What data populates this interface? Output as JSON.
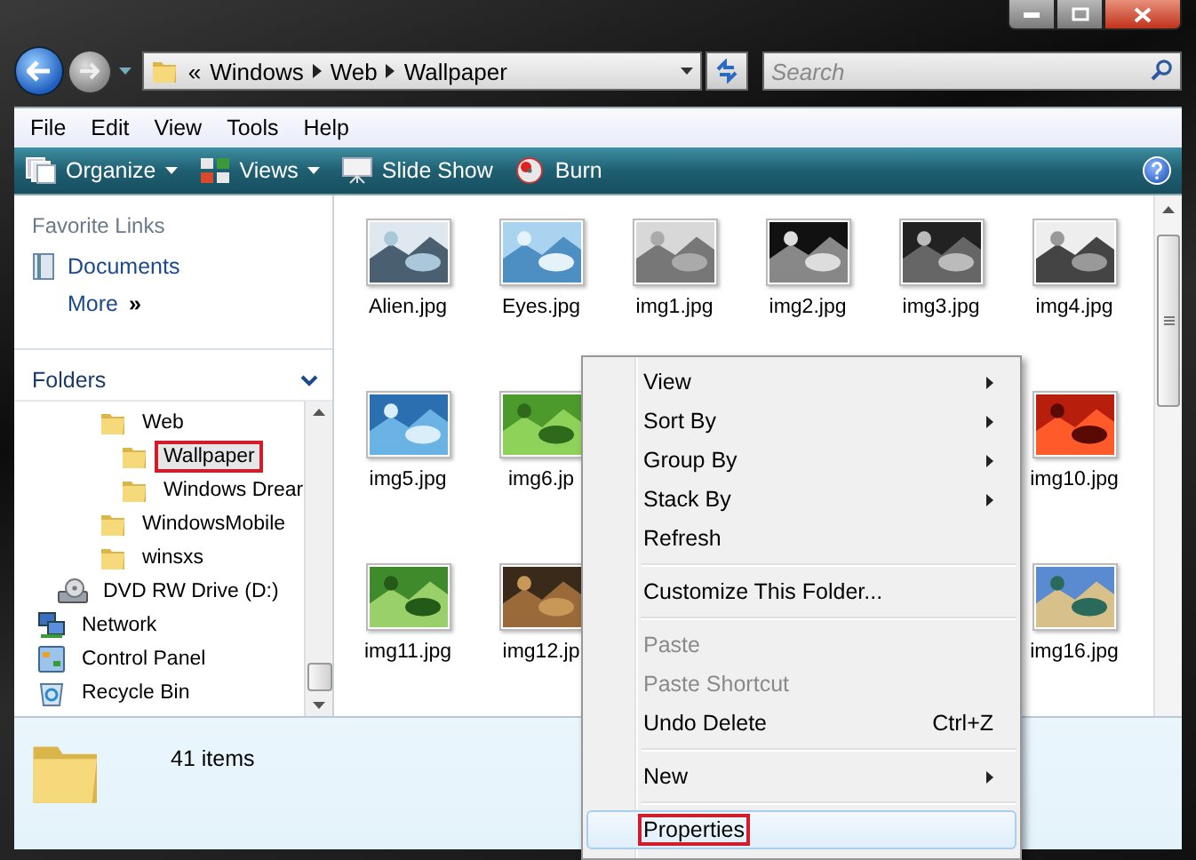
{
  "address_bar": {
    "overflow": "«",
    "crumbs": [
      "Windows",
      "Web",
      "Wallpaper"
    ]
  },
  "search": {
    "placeholder": "Search"
  },
  "menu_bar": [
    "File",
    "Edit",
    "View",
    "Tools",
    "Help"
  ],
  "toolbar": [
    {
      "label": "Organize",
      "kind": "organize",
      "has_menu": true
    },
    {
      "label": "Views",
      "kind": "views",
      "has_menu": true
    },
    {
      "label": "Slide Show",
      "kind": "slideshow",
      "has_menu": false
    },
    {
      "label": "Burn",
      "kind": "burn",
      "has_menu": false
    }
  ],
  "navigation_pane": {
    "favorites_title": "Favorite Links",
    "favorites": [
      {
        "label": "Documents",
        "kind": "documents"
      },
      {
        "label": "More",
        "kind": "more",
        "suffix": "»"
      }
    ],
    "folders_title": "Folders",
    "tree": [
      {
        "children": [
          {
            "children": [
              {
                "children": [
                  {
                    "label": "Web",
                    "kind": "folder",
                    "selected": false,
                    "highlighted": false,
                    "children": [
                      {
                        "label": "Wallpaper",
                        "kind": "folder",
                        "selected": true,
                        "highlighted": true
                      },
                      {
                        "label": "Windows Drear",
                        "kind": "folder",
                        "selected": false,
                        "highlighted": false
                      }
                    ]
                  },
                  {
                    "label": "WindowsMobile",
                    "kind": "folder",
                    "selected": false,
                    "highlighted": false
                  },
                  {
                    "label": "winsxs",
                    "kind": "folder",
                    "selected": false,
                    "highlighted": false
                  }
                ]
              }
            ]
          },
          {
            "label": "DVD RW Drive (D:)",
            "kind": "drive",
            "selected": false,
            "highlighted": false
          }
        ]
      },
      {
        "label": "Network",
        "kind": "network",
        "selected": false,
        "highlighted": false
      },
      {
        "label": "Control Panel",
        "kind": "control-panel",
        "selected": false,
        "highlighted": false
      },
      {
        "label": "Recycle Bin",
        "kind": "recycle-bin",
        "selected": false,
        "highlighted": false
      }
    ]
  },
  "files": {
    "rows": [
      [
        {
          "name": "Alien.jpg"
        },
        {
          "name": "Eyes.jpg"
        },
        {
          "name": "img1.jpg"
        },
        {
          "name": "img2.jpg"
        },
        {
          "name": "img3.jpg"
        },
        {
          "name": "img4.jpg"
        }
      ],
      [
        {
          "name": "img5.jpg"
        },
        {
          "name": "img6.jp"
        },
        {
          "name": "img10.jpg"
        }
      ],
      [
        {
          "name": "img11.jpg"
        },
        {
          "name": "img12.jp"
        },
        {
          "name": "img16.jpg"
        }
      ]
    ]
  },
  "context_menu": [
    {
      "kind": "item",
      "label": "View",
      "submenu": true,
      "disabled": false,
      "hovered": false,
      "highlighted": false
    },
    {
      "kind": "item",
      "label": "Sort By",
      "submenu": true,
      "disabled": false,
      "hovered": false,
      "highlighted": false
    },
    {
      "kind": "item",
      "label": "Group By",
      "submenu": true,
      "disabled": false,
      "hovered": false,
      "highlighted": false
    },
    {
      "kind": "item",
      "label": "Stack By",
      "submenu": true,
      "disabled": false,
      "hovered": false,
      "highlighted": false
    },
    {
      "kind": "item",
      "label": "Refresh",
      "submenu": false,
      "disabled": false,
      "hovered": false,
      "highlighted": false
    },
    {
      "kind": "separator"
    },
    {
      "kind": "item",
      "label": "Customize This Folder...",
      "submenu": false,
      "disabled": false,
      "hovered": false,
      "highlighted": false
    },
    {
      "kind": "separator"
    },
    {
      "kind": "item",
      "label": "Paste",
      "submenu": false,
      "disabled": true,
      "hovered": false,
      "highlighted": false
    },
    {
      "kind": "item",
      "label": "Paste Shortcut",
      "submenu": false,
      "disabled": true,
      "hovered": false,
      "highlighted": false
    },
    {
      "kind": "item",
      "label": "Undo Delete",
      "shortcut": "Ctrl+Z",
      "submenu": false,
      "disabled": false,
      "hovered": false,
      "highlighted": false
    },
    {
      "kind": "separator"
    },
    {
      "kind": "item",
      "label": "New",
      "submenu": true,
      "disabled": false,
      "hovered": false,
      "highlighted": false
    },
    {
      "kind": "separator"
    },
    {
      "kind": "item",
      "label": "Properties",
      "submenu": false,
      "disabled": false,
      "hovered": true,
      "highlighted": true
    }
  ],
  "details_pane": {
    "summary": "41 items"
  }
}
